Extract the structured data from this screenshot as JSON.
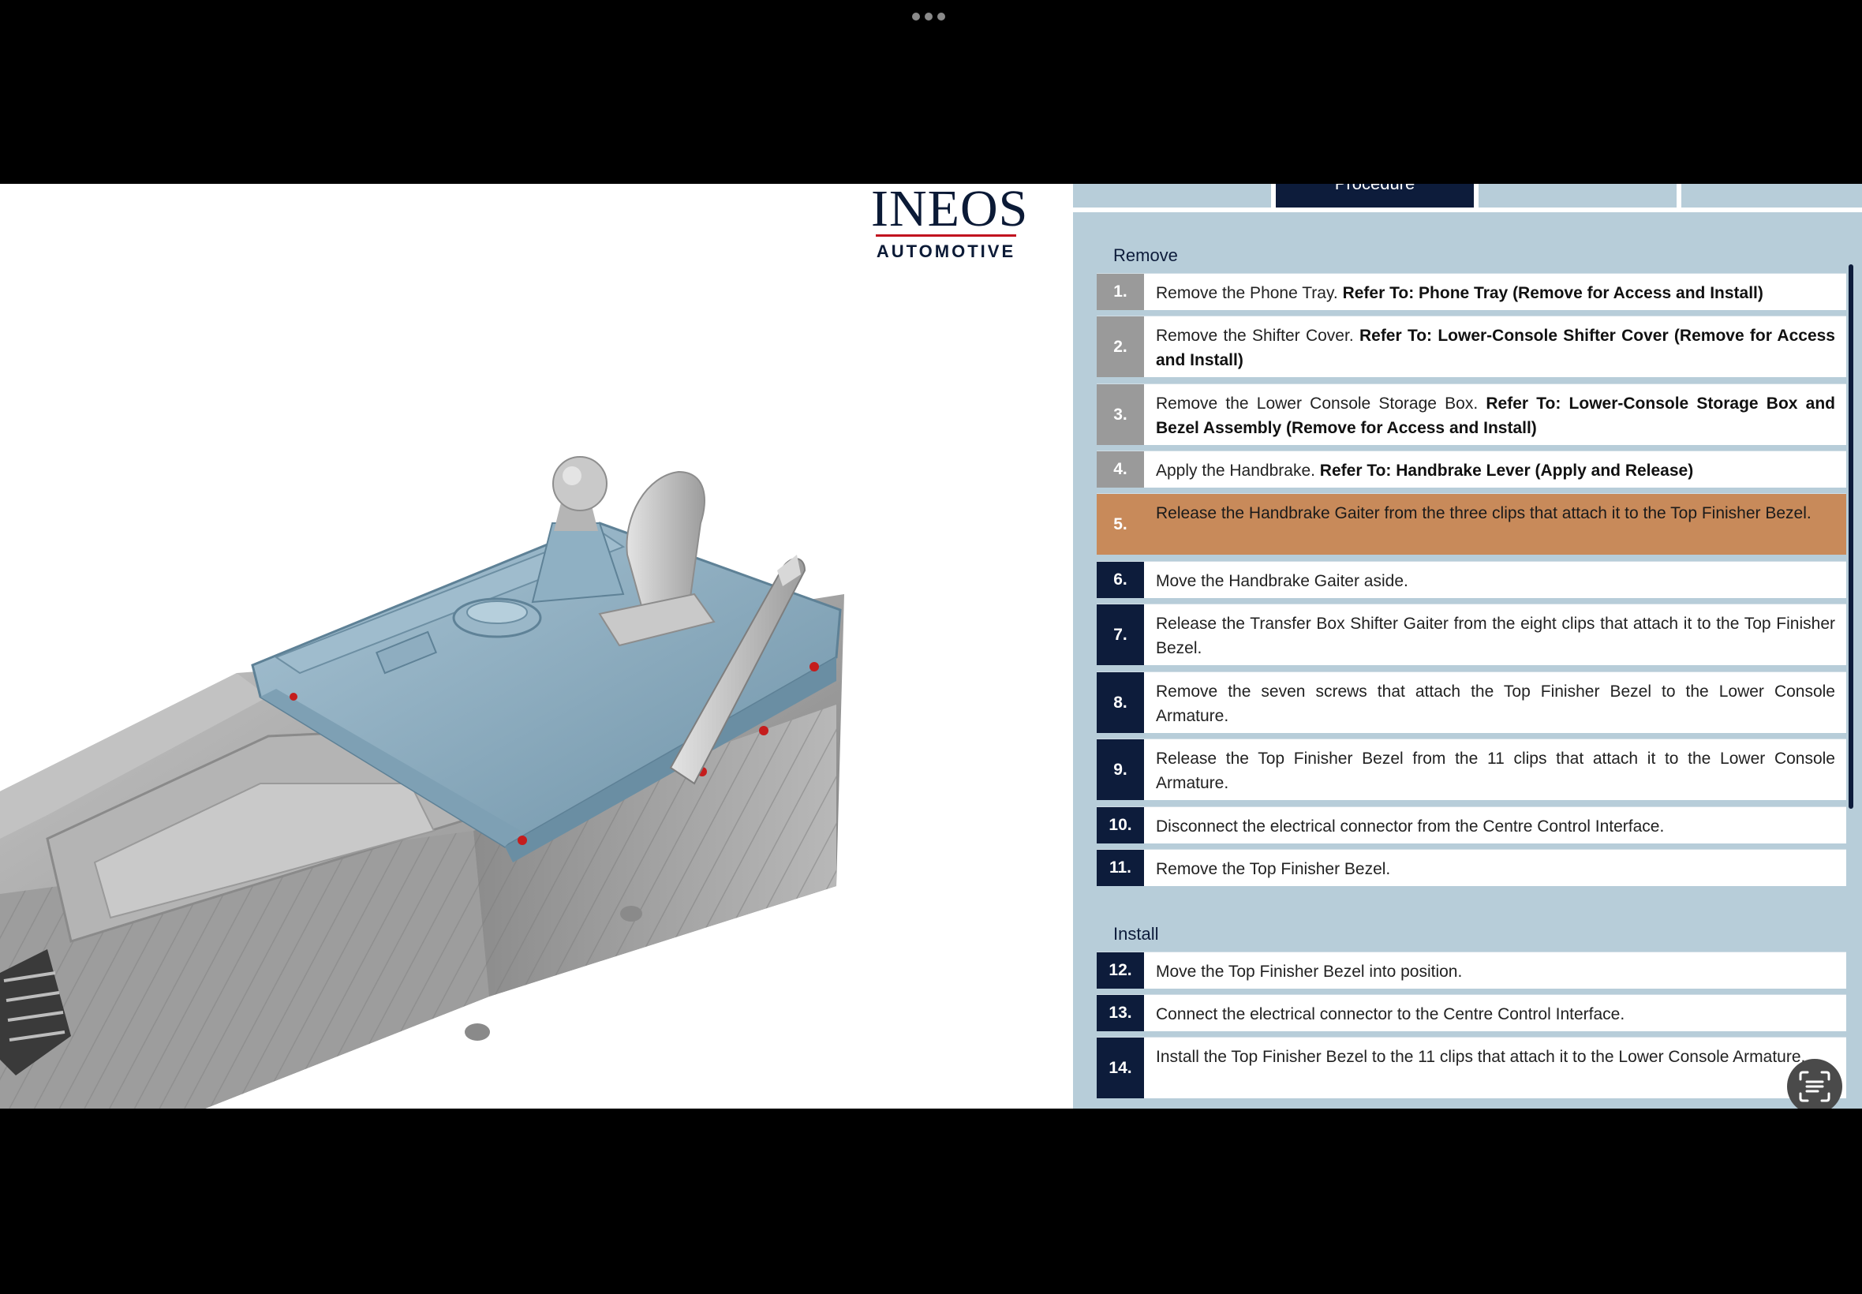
{
  "brand": {
    "name": "INEOS",
    "sub": "AUTOMOTIVE"
  },
  "tabs": [
    {
      "label": ""
    },
    {
      "label": "Procedure"
    },
    {
      "label": ""
    },
    {
      "label": ""
    }
  ],
  "sections": {
    "remove": "Remove",
    "install": "Install"
  },
  "steps": [
    {
      "num": "1.",
      "text": "Remove the Phone Tray. ",
      "ref": "Refer To: Phone Tray (Remove for Access and Install)"
    },
    {
      "num": "2.",
      "text": "Remove the Shifter Cover. ",
      "ref": "Refer To: Lower-Console Shifter Cover (Remove for Access and Install)"
    },
    {
      "num": "3.",
      "text": "Remove the Lower Console Storage Box. ",
      "ref": "Refer To: Lower-Console Storage Box and Bezel Assembly (Remove for Access and Install)"
    },
    {
      "num": "4.",
      "text": "Apply the Handbrake. ",
      "ref": "Refer To: Handbrake Lever (Apply and Release)"
    },
    {
      "num": "5.",
      "text": "Release the Handbrake Gaiter from the three clips that attach it to the Top Finisher Bezel.",
      "ref": ""
    },
    {
      "num": "6.",
      "text": "Move the Handbrake Gaiter aside.",
      "ref": ""
    },
    {
      "num": "7.",
      "text": "Release the Transfer Box Shifter Gaiter from the eight clips that attach it to the Top Finisher Bezel.",
      "ref": ""
    },
    {
      "num": "8.",
      "text": "Remove the seven screws that attach the Top Finisher Bezel to the Lower Console Armature.",
      "ref": ""
    },
    {
      "num": "9.",
      "text": "Release the Top Finisher Bezel from the 11 clips that attach it to the Lower Console Armature.",
      "ref": ""
    },
    {
      "num": "10.",
      "text": "Disconnect the electrical connector from the Centre Control Interface.",
      "ref": ""
    },
    {
      "num": "11.",
      "text": "Remove the Top Finisher Bezel.",
      "ref": ""
    },
    {
      "num": "12.",
      "text": "Move the Top Finisher Bezel into position.",
      "ref": ""
    },
    {
      "num": "13.",
      "text": "Connect the electrical connector to the Centre Control Interface.",
      "ref": ""
    },
    {
      "num": "14.",
      "text": "Install the Top Finisher Bezel to the 11 clips that attach it to the Lower Console Armature.",
      "ref": ""
    }
  ],
  "colors": {
    "navy": "#0d1c3b",
    "panel_blue": "#b7cdd9",
    "highlight": "#c88a5a",
    "bezel_blue": "#8fb0c4",
    "armature_grey": "#a9a9a9"
  },
  "icons": {
    "fab": "text-scan-icon",
    "menu": "more-dots-icon"
  }
}
